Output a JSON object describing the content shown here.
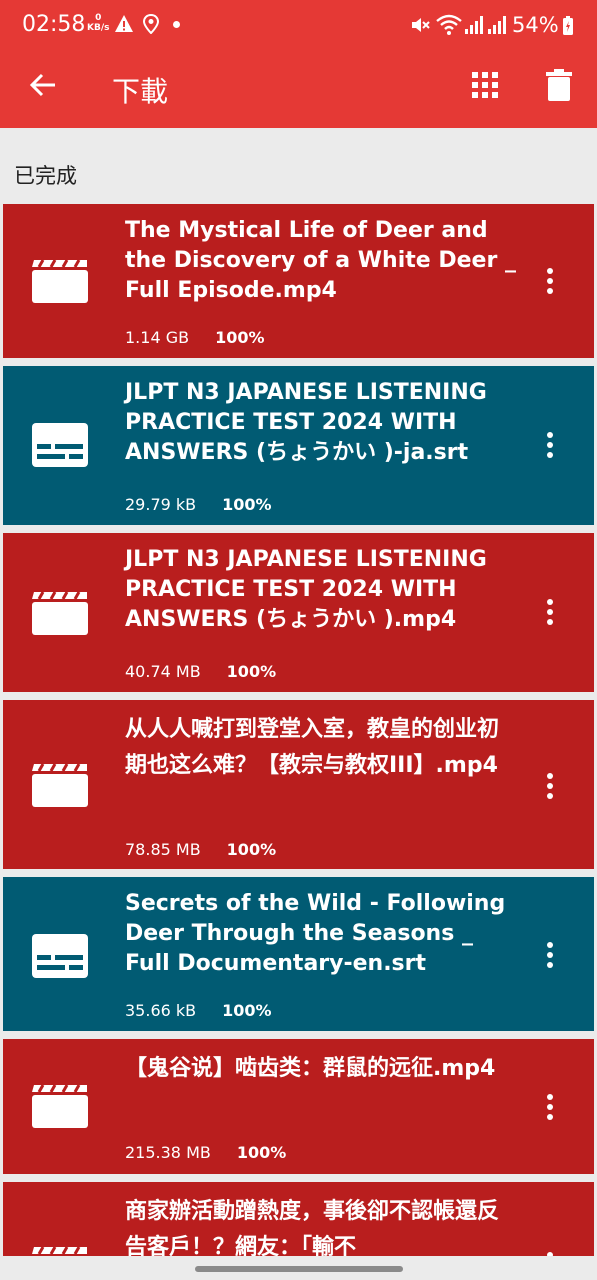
{
  "status_bar": {
    "time": "02:58",
    "net_speed_value": "0",
    "net_speed_unit": "KB/s",
    "battery": "54%",
    "icons": [
      "warning-icon",
      "location-icon",
      "dot-icon",
      "mute-icon",
      "wifi-icon",
      "signal-icon",
      "signal-icon",
      "battery-icon"
    ]
  },
  "app_bar": {
    "title": "下載",
    "icons": [
      "back-arrow-icon",
      "grid-view-icon",
      "trash-icon"
    ]
  },
  "section_title": "已完成",
  "colors": {
    "accent": "#e53935",
    "video_row": "#b91e1e",
    "subtitle_row": "#015b73"
  },
  "items": [
    {
      "type": "video",
      "icon": "video-clapper-icon",
      "name": "The Mystical Life of Deer and the Discovery of a White Deer _ Full Episode.mp4",
      "size": "1.14 GB",
      "progress": "100%"
    },
    {
      "type": "subtitle",
      "icon": "subtitle-icon",
      "name": "JLPT N3 JAPANESE LISTENING PRACTICE TEST 2024 WITH ANSWERS (ちょうかい )-ja.srt",
      "size": "29.79 kB",
      "progress": "100%"
    },
    {
      "type": "video",
      "icon": "video-clapper-icon",
      "name": "JLPT N3 JAPANESE LISTENING PRACTICE TEST 2024 WITH ANSWERS (ちょうかい ).mp4",
      "size": "40.74 MB",
      "progress": "100%"
    },
    {
      "type": "video",
      "icon": "video-clapper-icon",
      "name": "从人人喊打到登堂入室，教皇的创业初期也这么难？【教宗与教权III】.mp4",
      "size": "78.85 MB",
      "progress": "100%"
    },
    {
      "type": "subtitle",
      "icon": "subtitle-icon",
      "name": "Secrets of the Wild - Following Deer Through the Seasons _ Full Documentary-en.srt",
      "size": "35.66 kB",
      "progress": "100%"
    },
    {
      "type": "video",
      "icon": "video-clapper-icon",
      "name": "【鬼谷说】啮齿类：群鼠的远征.mp4",
      "size": "215.38 MB",
      "progress": "100%"
    },
    {
      "type": "video",
      "icon": "video-clapper-icon",
      "name": "商家辦活動蹭熱度，事後卻不認帳還反告客戶！？網友：「輸不",
      "size": "",
      "progress": ""
    }
  ]
}
